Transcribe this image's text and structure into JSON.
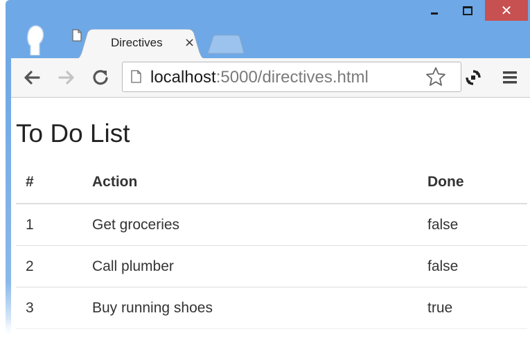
{
  "window": {
    "controls": {
      "minimize_icon": "minimize-icon",
      "maximize_icon": "maximize-icon",
      "close_glyph": "✕"
    },
    "accent_color": "#6ea8e6",
    "close_color": "#c75050"
  },
  "tabs": [
    {
      "title": "Directives",
      "close_glyph": "×",
      "active": true
    }
  ],
  "toolbar": {
    "url_host": "localhost",
    "url_rest": ":5000/directives.html",
    "icons": [
      "back-arrow-icon",
      "forward-arrow-icon",
      "reload-icon",
      "page-icon",
      "star-icon",
      "extension-icon",
      "menu-icon"
    ]
  },
  "page": {
    "title": "To Do List",
    "table": {
      "headers": [
        "#",
        "Action",
        "Done"
      ],
      "rows": [
        {
          "num": "1",
          "action": "Get groceries",
          "done": "false"
        },
        {
          "num": "2",
          "action": "Call plumber",
          "done": "false"
        },
        {
          "num": "3",
          "action": "Buy running shoes",
          "done": "true"
        }
      ]
    }
  }
}
